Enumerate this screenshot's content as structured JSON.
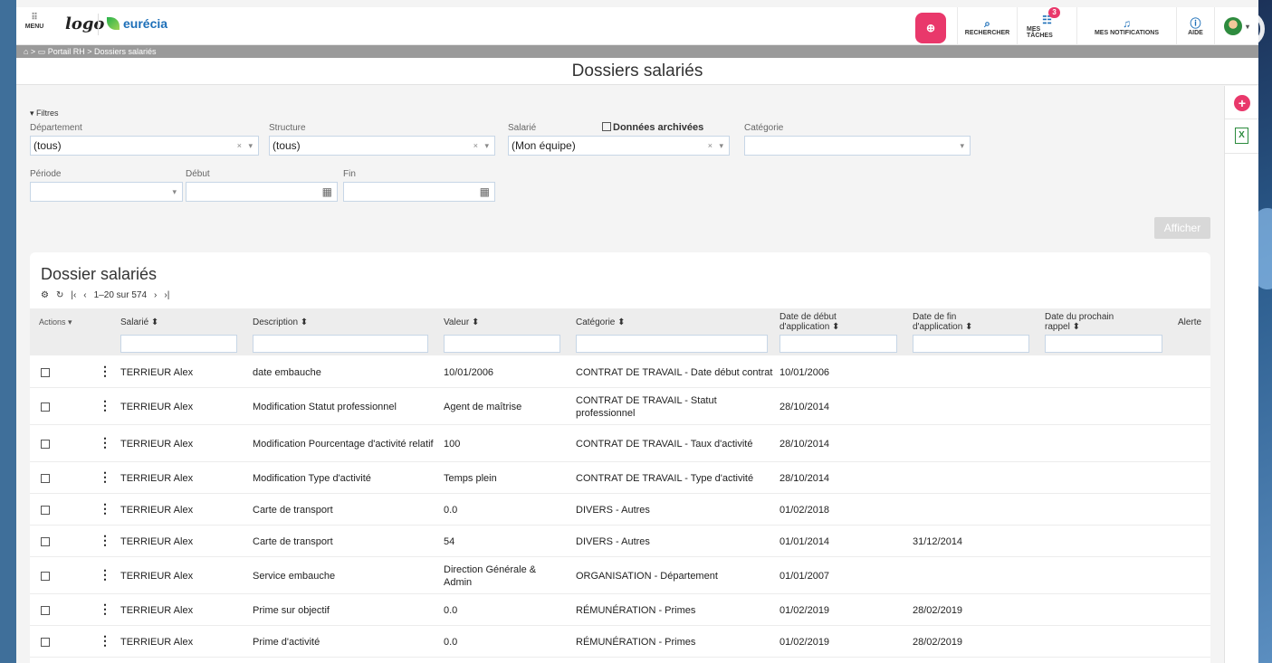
{
  "topbar": {
    "menu_label": "MENU",
    "logo_text": "logo",
    "brand_name": "eurécia",
    "search_label": "RECHERCHER",
    "tasks_label": "MES TÂCHES",
    "tasks_badge": "3",
    "notifications_label": "MES NOTIFICATIONS",
    "help_label": "AIDE"
  },
  "breadcrumb": "⌂ > ▭ Portail RH > Dossiers salariés",
  "page_title": "Dossiers salariés",
  "filters": {
    "toggle_label": "▾ Filtres",
    "departement_label": "Département",
    "departement_value": "(tous)",
    "structure_label": "Structure",
    "structure_value": "(tous)",
    "salarie_label": "Salarié",
    "salarie_value": "(Mon équipe)",
    "archived_label": "Données archivées",
    "categorie_label": "Catégorie",
    "categorie_value": "",
    "periode_label": "Période",
    "periode_value": "",
    "debut_label": "Début",
    "fin_label": "Fin",
    "clear_symbol": "×",
    "caret_symbol": "▾",
    "calendar_symbol": "▦"
  },
  "afficher_label": "Afficher",
  "table": {
    "title": "Dossier salariés",
    "pager_text": "1–20 sur 574",
    "headers": {
      "actions": "Actions ▾",
      "salarie": "Salarié ⬍",
      "description": "Description ⬍",
      "valeur": "Valeur ⬍",
      "categorie": "Catégorie ⬍",
      "debut_1": "Date de début",
      "debut_2": "d'application ⬍",
      "fin_1": "Date de fin",
      "fin_2": "d'application ⬍",
      "rappel_1": "Date du prochain",
      "rappel_2": "rappel ⬍",
      "alerte": "Alerte"
    },
    "rows": [
      {
        "salarie": "TERRIEUR Alex",
        "description": "date embauche",
        "valeur": "10/01/2006",
        "categorie": "CONTRAT DE TRAVAIL - Date début contrat",
        "debut": "10/01/2006",
        "fin": "",
        "rappel": ""
      },
      {
        "salarie": "TERRIEUR Alex",
        "description": "Modification Statut professionnel",
        "valeur": "Agent de maîtrise",
        "categorie": "CONTRAT DE TRAVAIL - Statut professionnel",
        "debut": "28/10/2014",
        "fin": "",
        "rappel": ""
      },
      {
        "salarie": "TERRIEUR Alex",
        "description": "Modification Pourcentage d'activité relatif",
        "valeur": "100",
        "categorie": "CONTRAT DE TRAVAIL - Taux d'activité",
        "debut": "28/10/2014",
        "fin": "",
        "rappel": ""
      },
      {
        "salarie": "TERRIEUR Alex",
        "description": "Modification Type d'activité",
        "valeur": "Temps plein",
        "categorie": "CONTRAT DE TRAVAIL - Type d'activité",
        "debut": "28/10/2014",
        "fin": "",
        "rappel": ""
      },
      {
        "salarie": "TERRIEUR Alex",
        "description": "Carte de transport",
        "valeur": "0.0",
        "categorie": "DIVERS - Autres",
        "debut": "01/02/2018",
        "fin": "",
        "rappel": ""
      },
      {
        "salarie": "TERRIEUR Alex",
        "description": "Carte de transport",
        "valeur": "54",
        "categorie": "DIVERS - Autres",
        "debut": "01/01/2014",
        "fin": "31/12/2014",
        "rappel": ""
      },
      {
        "salarie": "TERRIEUR Alex",
        "description": "Service embauche",
        "valeur": "Direction Générale & Admin",
        "categorie": "ORGANISATION - Département",
        "debut": "01/01/2007",
        "fin": "",
        "rappel": ""
      },
      {
        "salarie": "TERRIEUR Alex",
        "description": "Prime sur objectif",
        "valeur": "0.0",
        "categorie": "RÉMUNÉRATION - Primes",
        "debut": "01/02/2019",
        "fin": "28/02/2019",
        "rappel": ""
      },
      {
        "salarie": "TERRIEUR Alex",
        "description": "Prime d'activité",
        "valeur": "0.0",
        "categorie": "RÉMUNÉRATION - Primes",
        "debut": "01/02/2019",
        "fin": "28/02/2019",
        "rappel": ""
      }
    ]
  },
  "side": {
    "add_symbol": "+",
    "excel_symbol": "X"
  },
  "colors": {
    "accent": "#e9386b",
    "brand_blue": "#1d6fb8",
    "excel_green": "#2a8a3c"
  }
}
